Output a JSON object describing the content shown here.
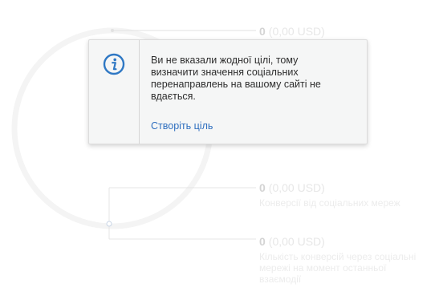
{
  "metrics": [
    {
      "value": "0",
      "usd": "(0,00 USD)",
      "description": ""
    },
    {
      "value": "0",
      "usd": "(0,00 USD)",
      "description": "Конверсії від соціальних мереж"
    },
    {
      "value": "0",
      "usd": "(0,00 USD)",
      "description": "Кількість конверсій через соціальні мережі на момент останньої взаємодії"
    }
  ],
  "notice": {
    "icon": "info-icon",
    "message": "Ви не вказали жодної цілі, тому визначити значення соціальних перенаправлень на вашому сайті не вдається.",
    "link_label": "Створіть ціль"
  },
  "colors": {
    "accent": "#2f6fbf",
    "icon_stroke": "#2f78c4"
  }
}
